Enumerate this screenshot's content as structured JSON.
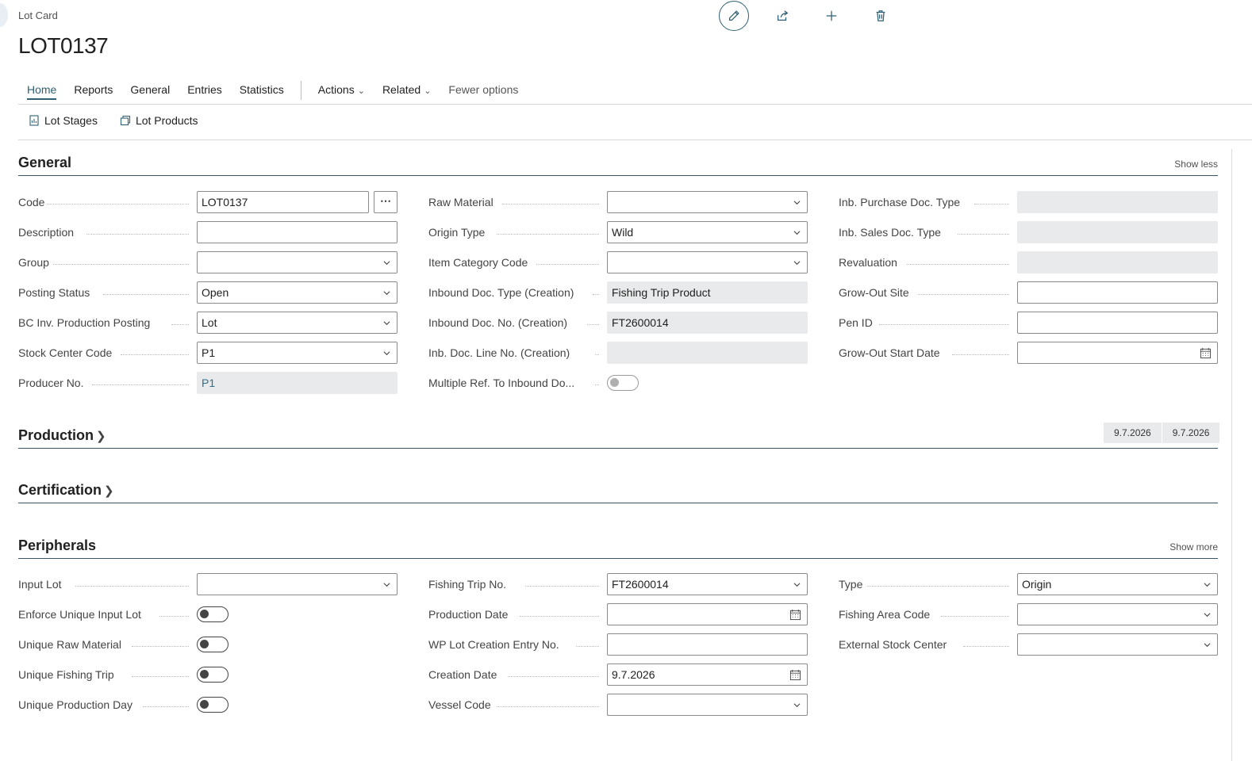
{
  "breadcrumb": "Lot Card",
  "page_title": "LOT0137",
  "top_actions": {
    "icons": [
      "edit-icon",
      "share-icon",
      "add-icon",
      "delete-icon"
    ]
  },
  "tabs": {
    "home": "Home",
    "reports": "Reports",
    "general": "General",
    "entries": "Entries",
    "statistics": "Statistics",
    "actions": "Actions",
    "related": "Related",
    "fewer": "Fewer options"
  },
  "subactions": {
    "lot_stages": "Lot Stages",
    "lot_products": "Lot Products"
  },
  "sections": {
    "general": {
      "title": "General",
      "link": "Show less"
    },
    "production": {
      "title": "Production",
      "chips": [
        "9.7.2026",
        "9.7.2026"
      ]
    },
    "certification": {
      "title": "Certification"
    },
    "peripherals": {
      "title": "Peripherals",
      "link": "Show more"
    }
  },
  "general_col1": [
    {
      "label": "Code",
      "value": "LOT0137",
      "kind": "text-ellipsis"
    },
    {
      "label": "Description",
      "value": "",
      "kind": "text"
    },
    {
      "label": "Group",
      "value": "",
      "kind": "dropdown"
    },
    {
      "label": "Posting Status",
      "value": "Open",
      "kind": "dropdown"
    },
    {
      "label": "BC Inv. Production Posting",
      "value": "Lot",
      "kind": "dropdown"
    },
    {
      "label": "Stock Center Code",
      "value": "P1",
      "kind": "dropdown"
    },
    {
      "label": "Producer No.",
      "value": "P1",
      "kind": "readonly-link"
    }
  ],
  "general_col2": [
    {
      "label": "Raw Material",
      "value": "",
      "kind": "dropdown"
    },
    {
      "label": "Origin Type",
      "value": "Wild",
      "kind": "dropdown"
    },
    {
      "label": "Item Category Code",
      "value": "",
      "kind": "dropdown"
    },
    {
      "label": "Inbound Doc. Type (Creation)",
      "value": "Fishing Trip Product",
      "kind": "readonly"
    },
    {
      "label": "Inbound Doc. No. (Creation)",
      "value": "FT2600014",
      "kind": "readonly"
    },
    {
      "label": "Inb. Doc. Line No. (Creation)",
      "value": "",
      "kind": "readonly"
    },
    {
      "label": "Multiple Ref. To Inbound Do...",
      "value": "off",
      "kind": "toggle-disabled"
    }
  ],
  "general_col3": [
    {
      "label": "Inb. Purchase Doc. Type",
      "value": "",
      "kind": "readonly"
    },
    {
      "label": "Inb. Sales Doc. Type",
      "value": "",
      "kind": "readonly"
    },
    {
      "label": "Revaluation",
      "value": "",
      "kind": "readonly"
    },
    {
      "label": "Grow-Out Site",
      "value": "",
      "kind": "text"
    },
    {
      "label": "Pen ID",
      "value": "",
      "kind": "text"
    },
    {
      "label": "Grow-Out Start Date",
      "value": "",
      "kind": "date"
    }
  ],
  "peripherals_col1": [
    {
      "label": "Input Lot",
      "value": "",
      "kind": "dropdown"
    },
    {
      "label": "Enforce Unique Input Lot",
      "value": "off",
      "kind": "toggle"
    },
    {
      "label": "Unique Raw Material",
      "value": "off",
      "kind": "toggle"
    },
    {
      "label": "Unique Fishing Trip",
      "value": "off",
      "kind": "toggle"
    },
    {
      "label": "Unique Production Day",
      "value": "off",
      "kind": "toggle"
    }
  ],
  "peripherals_col2": [
    {
      "label": "Fishing Trip No.",
      "value": "FT2600014",
      "kind": "dropdown"
    },
    {
      "label": "Production Date",
      "value": "",
      "kind": "date"
    },
    {
      "label": "WP Lot Creation Entry No.",
      "value": "",
      "kind": "text"
    },
    {
      "label": "Creation Date",
      "value": "9.7.2026",
      "kind": "date"
    },
    {
      "label": "Vessel Code",
      "value": "",
      "kind": "dropdown"
    }
  ],
  "peripherals_col3": [
    {
      "label": "Type",
      "value": "Origin",
      "kind": "dropdown"
    },
    {
      "label": "Fishing Area Code",
      "value": "",
      "kind": "dropdown"
    },
    {
      "label": "External Stock Center",
      "value": "",
      "kind": "dropdown"
    }
  ],
  "colors": {
    "accent": "#2f5f74",
    "readonly_bg": "#e9eaeb",
    "link": "#2f6f8a"
  }
}
